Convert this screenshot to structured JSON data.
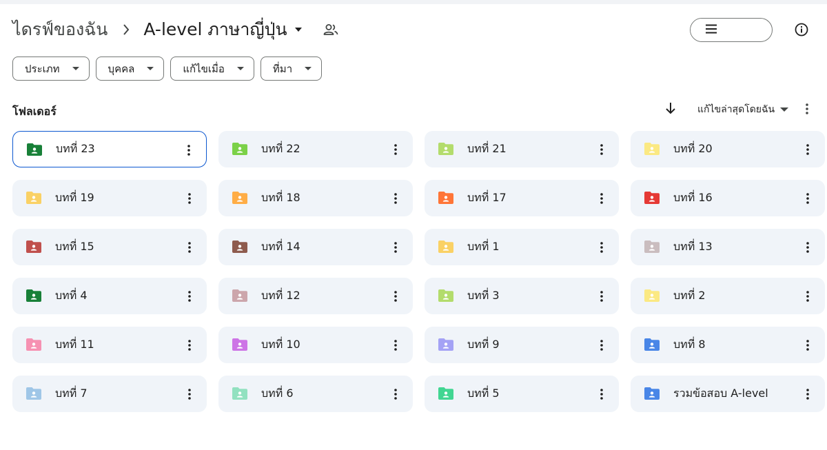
{
  "breadcrumb": {
    "root": "ไดรฟ์ของฉัน",
    "current": "A-level ภาษาญี่ปุ่น"
  },
  "view": {
    "mode": "grid"
  },
  "filters": [
    {
      "label": "ประเภท"
    },
    {
      "label": "บุคคล"
    },
    {
      "label": "แก้ไขเมื่อ"
    },
    {
      "label": "ที่มา"
    }
  ],
  "section": {
    "title": "โฟลเดอร์",
    "sort_label": "แก้ไขล่าสุดโดยฉัน"
  },
  "folders": [
    {
      "name": "บทที่ 23",
      "color": "#188038",
      "selected": true
    },
    {
      "name": "บทที่ 22",
      "color": "#7bd148"
    },
    {
      "name": "บทที่ 21",
      "color": "#b3dc6c"
    },
    {
      "name": "บทที่ 20",
      "color": "#fbe983"
    },
    {
      "name": "บทที่ 19",
      "color": "#fad165"
    },
    {
      "name": "บทที่ 18",
      "color": "#ffad46"
    },
    {
      "name": "บทที่ 17",
      "color": "#ff7537"
    },
    {
      "name": "บทที่ 16",
      "color": "#e53935"
    },
    {
      "name": "บทที่ 15",
      "color": "#c0504d"
    },
    {
      "name": "บทที่ 14",
      "color": "#8e5b4e"
    },
    {
      "name": "บทที่ 1",
      "color": "#fad165"
    },
    {
      "name": "บทที่ 13",
      "color": "#cabdbf"
    },
    {
      "name": "บทที่ 4",
      "color": "#188038"
    },
    {
      "name": "บทที่ 12",
      "color": "#cca6ac"
    },
    {
      "name": "บทที่ 3",
      "color": "#b3dc6c"
    },
    {
      "name": "บทที่ 2",
      "color": "#fbe983"
    },
    {
      "name": "บทที่ 11",
      "color": "#f691b2"
    },
    {
      "name": "บทที่ 10",
      "color": "#cd74e6"
    },
    {
      "name": "บทที่ 9",
      "color": "#a4a2f5"
    },
    {
      "name": "บทที่ 8",
      "color": "#4986e7"
    },
    {
      "name": "บทที่ 7",
      "color": "#9fc6e7"
    },
    {
      "name": "บทที่ 6",
      "color": "#92e1c0"
    },
    {
      "name": "บทที่ 5",
      "color": "#42d692"
    },
    {
      "name": "รวมข้อสอบ A-level",
      "color": "#4986e7"
    }
  ],
  "icons": {
    "chevron": "chevron-right-icon",
    "share": "shared-people-icon",
    "list": "list-view-icon",
    "grid": "grid-view-icon",
    "info": "info-icon",
    "sort": "arrow-down-icon",
    "more": "more-vert-icon",
    "folder": "shared-folder-icon"
  }
}
